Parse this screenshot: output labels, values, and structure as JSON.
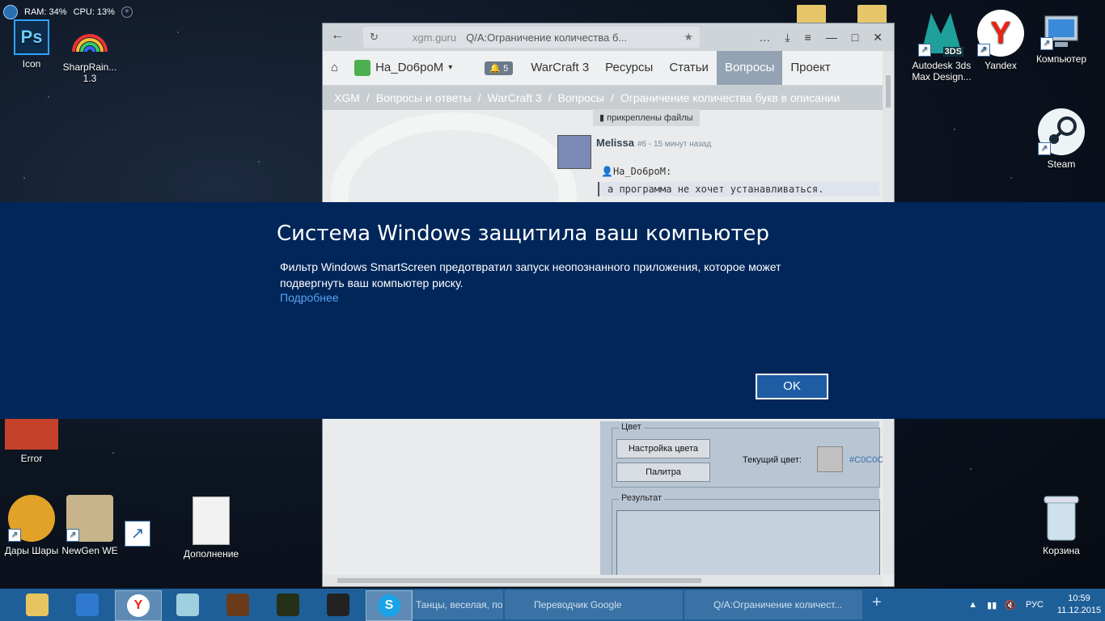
{
  "gadget": {
    "ram": "RAM: 34%",
    "cpu": "CPU: 13%"
  },
  "desktop_icons": [
    {
      "label": "Icon"
    },
    {
      "label": "SharpRain... 1.3"
    },
    {
      "label": "Autodesk 3ds Max Design..."
    },
    {
      "label": "Yandex"
    },
    {
      "label": "Компьютер"
    },
    {
      "label": "Steam"
    },
    {
      "label": "Error"
    },
    {
      "label": "Дары Шары"
    },
    {
      "label": "NewGen WE"
    },
    {
      "label": "Дополнение"
    },
    {
      "label": "Корзина"
    }
  ],
  "badge_3ds": "3DS",
  "browser": {
    "domain": "xgm.guru",
    "tab_title": "Q/A:Ограничение количества б...",
    "nav": {
      "user": "На_Do6poM",
      "notifications": "5",
      "items": [
        "WarCraft 3",
        "Ресурсы",
        "Статьи",
        "Вопросы",
        "Проект"
      ]
    },
    "breadcrumb": [
      "XGM",
      "/",
      "Вопросы и ответы",
      "/",
      "WarCraft 3",
      "/",
      "Вопросы",
      "/",
      "Ограничение количества букв в описании"
    ],
    "attached": "прикреплены файлы",
    "post": {
      "author": "Melissa",
      "meta": "#6 - 15 минут назад",
      "quote_author": "На_Do6poM:",
      "quote_text": "а программа не хочет устанавливаться."
    },
    "lower": {
      "color_group": "Цвет",
      "btn_color_setup": "Настройка цвета",
      "btn_palette": "Палитра",
      "current_color_label": "Текущий цвет:",
      "current_color_value": "#C0C0C0",
      "result_group": "Результат"
    }
  },
  "smartscreen": {
    "title": "Система Windows защитила ваш компьютер",
    "body": "Фильтр Windows SmartScreen предотвратил запуск неопознанного приложения, которое может подвергнуть ваш компьютер риску.",
    "link": "Подробнее",
    "ok": "OK"
  },
  "taskbar": {
    "windows": [
      "Танцы, веселая, позити...",
      "Переводчик Google",
      "Q/A:Ограничение количест..."
    ],
    "lang": "РУС",
    "time": "10:59",
    "date": "11.12.2015"
  }
}
